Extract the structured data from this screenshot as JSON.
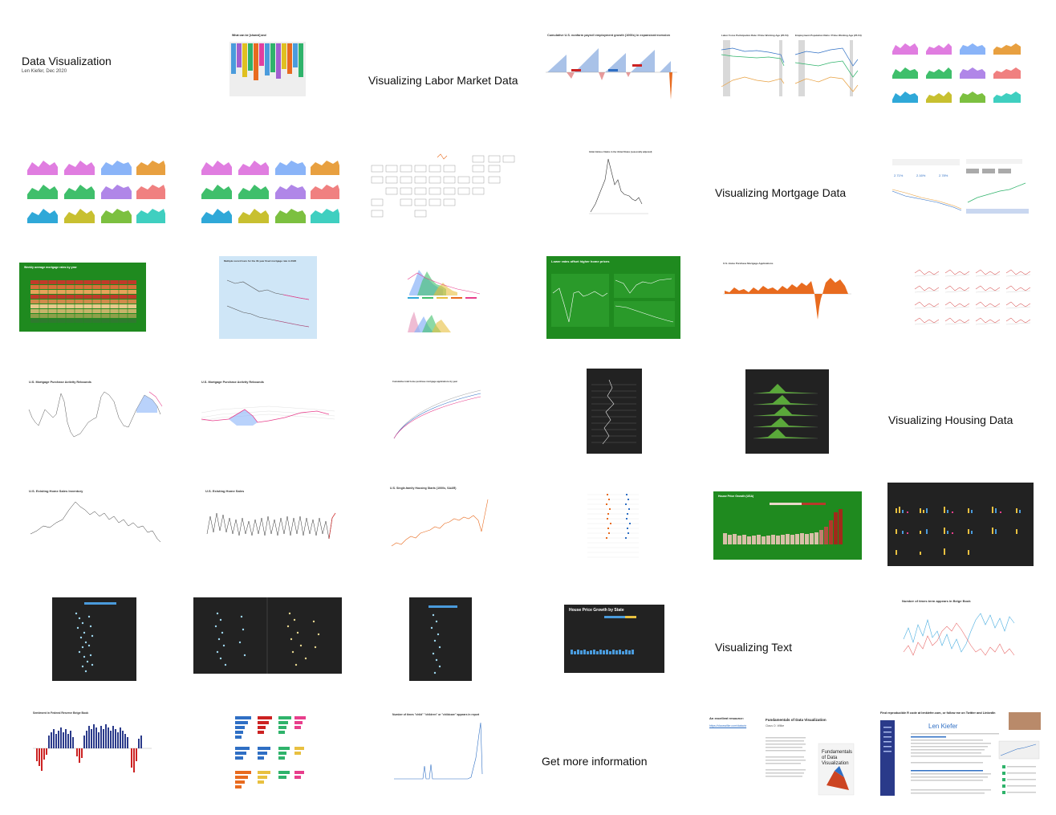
{
  "titles": {
    "dataviz": "Data Visualization",
    "dataviz_sub": "Len Kiefer, Dec 2020",
    "labor": "Visualizing Labor Market Data",
    "mortgage": "Visualizing Mortgage Data",
    "housing": "Visualizing Housing Data",
    "text": "Visualizing Text",
    "info": "Get more information"
  },
  "captions": {
    "payroll": "Cumulative U.S. nonfarm payroll employment growth (1000s) in expansion/recession",
    "lfpr": "Labor Force Participation Rate: Prime Working Age (25-54)",
    "epop": "Employment-Population Ratio: Prime Working Age (25-54)",
    "initial_claims": "Initial Jobless Claims in the United States (seasonally adjusted)",
    "mortgage_weekly": "Weekly average mortgage rates by year",
    "mortgage_30yr": "Multiple record lows for the 30-year fixed mortgage rate in 2020",
    "lower_rates": "Lower rates offset higher home prices",
    "purchase_apps": "U.S. Home Purchase Mortgage Applications",
    "purchase_rebound1": "U.S. Mortgage Purchase Activity Rebounds",
    "purchase_rebound2": "U.S. Mortgage Purchase Activity Rebounds",
    "cumulative_apps": "Cumulative total home purchase mortgage applications by year",
    "existing_inventory": "U.S. Existing Home Sales Inventory",
    "existing_sales": "U.S. Existing Home Sales",
    "starts": "U.S. Single-family Housing Starts (1000s, SAAR)",
    "house_price_usa": "House Price Growth (USA)",
    "house_price_state": "House Price Growth by State",
    "beige_count": "Number of times term appears in Beige Book",
    "beige_sentiment": "Sentiment in Federal Reserve Beige Book",
    "child_count": "Number of times \"child\" \"children\" or \"childcare\" appears in report",
    "excellent_resource": "An excellent resource:",
    "resource_url": "https://clauswilke.com/dataviz",
    "fundamentals": "Fundamentals of Data Visualization",
    "fundamentals_author": "Claus O. Wilke",
    "find_code": "Find reproducible R code at lenkiefer.com, or follow me on Twitter and LinkedIn",
    "len_kiefer": "Len Kiefer"
  },
  "colors": {
    "green": "#1f8a1f",
    "dark": "#222222",
    "orange": "#e8691b",
    "pink": "#e83e8c",
    "blue": "#2f6fc4",
    "red": "#cc2222"
  }
}
